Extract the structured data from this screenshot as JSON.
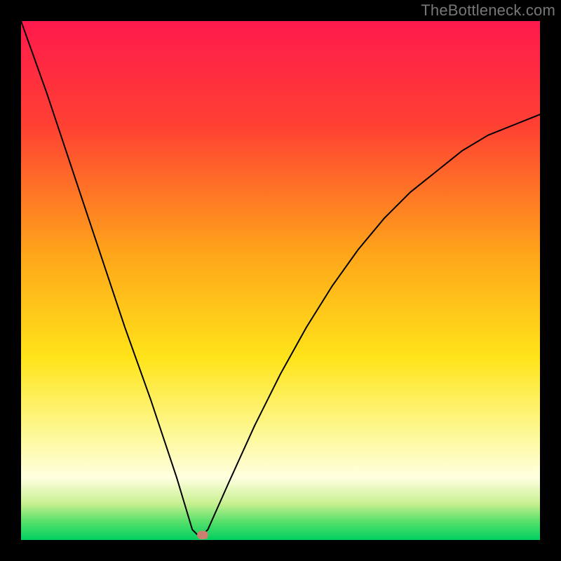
{
  "watermark": "TheBottleneck.com",
  "chart_data": {
    "type": "line",
    "title": "",
    "xlabel": "",
    "ylabel": "",
    "xlim": [
      0,
      100
    ],
    "ylim": [
      0,
      100
    ],
    "series": [
      {
        "name": "bottleneck-curve",
        "x": [
          0,
          5,
          10,
          15,
          20,
          25,
          30,
          33,
          34,
          35,
          36,
          40,
          45,
          50,
          55,
          60,
          65,
          70,
          75,
          80,
          85,
          90,
          95,
          100
        ],
        "values": [
          100,
          86,
          71,
          56,
          41,
          27,
          12,
          2,
          1,
          1,
          2,
          11,
          22,
          32,
          41,
          49,
          56,
          62,
          67,
          71,
          75,
          78,
          80,
          82
        ]
      }
    ],
    "optimum_point": {
      "x": 35,
      "y": 1
    },
    "gradient_stops": [
      {
        "pos": 0,
        "color": "#ff1a4d"
      },
      {
        "pos": 0.2,
        "color": "#ff4033"
      },
      {
        "pos": 0.45,
        "color": "#ffa61a"
      },
      {
        "pos": 0.65,
        "color": "#ffe41a"
      },
      {
        "pos": 0.8,
        "color": "#fdf99a"
      },
      {
        "pos": 0.88,
        "color": "#ffffe0"
      },
      {
        "pos": 0.93,
        "color": "#c8f090"
      },
      {
        "pos": 0.965,
        "color": "#55e06a"
      },
      {
        "pos": 1.0,
        "color": "#00d060"
      }
    ],
    "marker_color": "#c98070",
    "stroke_color": "#000000",
    "frame_color": "#000000"
  }
}
